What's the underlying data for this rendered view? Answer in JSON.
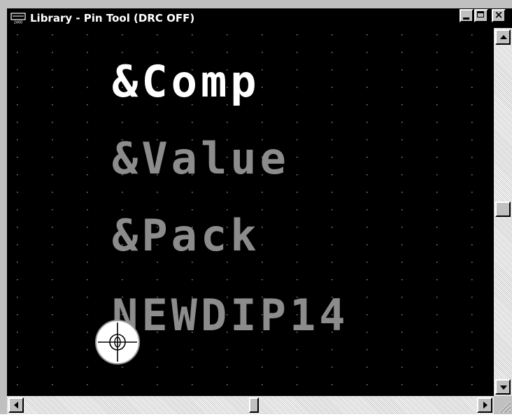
{
  "window": {
    "title": "Library - Pin Tool (DRC OFF)",
    "app_icon": "pcb-board-icon",
    "app_icon_caption": "2400",
    "controls": {
      "minimize": "minimize-icon",
      "maximize": "maximize-icon",
      "close": "close-icon"
    }
  },
  "canvas": {
    "background": "#000000",
    "grid_color": "#8a8a8a",
    "labels": [
      {
        "text": "&Comp",
        "color": "#ffffff",
        "role": "component-reference"
      },
      {
        "text": "&Value",
        "color": "#8c8c8c",
        "role": "value"
      },
      {
        "text": "&Pack",
        "color": "#8c8c8c",
        "role": "package"
      },
      {
        "text": "NEWDIP14",
        "color": "#8c8c8c",
        "role": "part-name"
      }
    ],
    "pin_cursor": {
      "icon": "pin-tool-cursor-icon",
      "color": "#ffffff"
    }
  },
  "scrollbars": {
    "vertical": {
      "up": "arrow-up-icon",
      "down": "arrow-down-icon"
    },
    "horizontal": {
      "left": "arrow-left-icon",
      "right": "arrow-right-icon"
    }
  },
  "colors": {
    "titlebar": "#000000",
    "chrome": "#c0c0c0"
  }
}
